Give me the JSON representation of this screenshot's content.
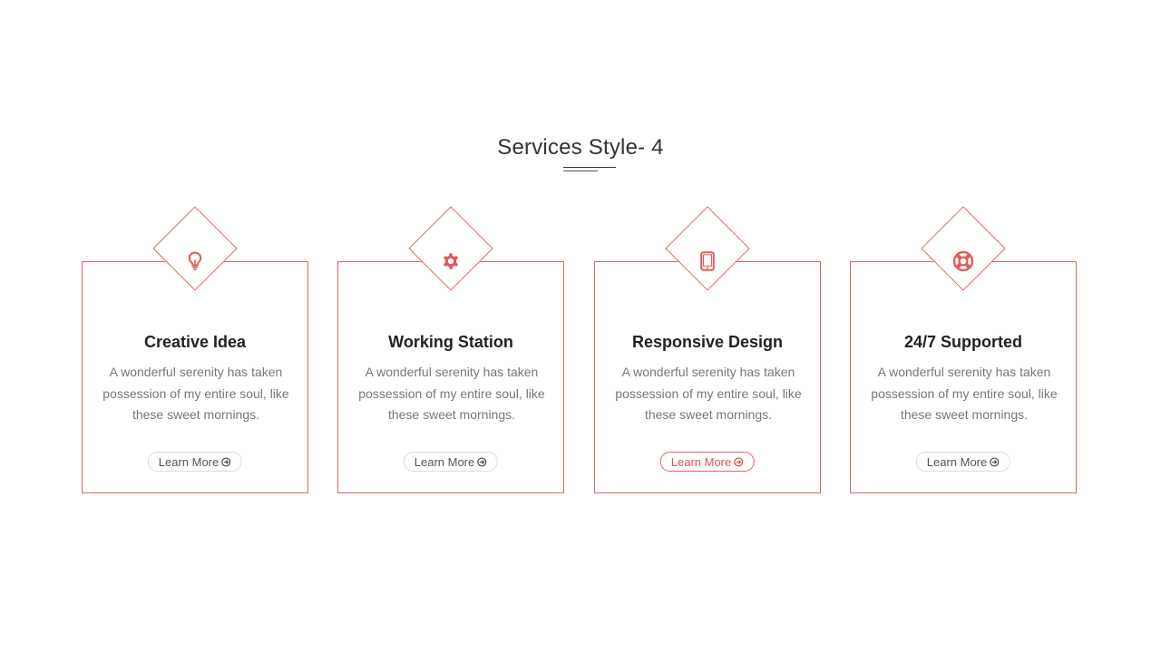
{
  "section": {
    "title": "Services Style- 4"
  },
  "colors": {
    "accent": "#e35a5a",
    "border": "#e06666",
    "title_text": "#333333",
    "body_text": "#777777"
  },
  "cards": [
    {
      "icon": "lightbulb-icon",
      "title": "Creative Idea",
      "text": "A wonderful serenity has taken possession of my entire soul, like these sweet mornings.",
      "button_label": "Learn More",
      "button_active": false
    },
    {
      "icon": "gear-icon",
      "title": "Working Station",
      "text": "A wonderful serenity has taken possession of my entire soul, like these sweet mornings.",
      "button_label": "Learn More",
      "button_active": false
    },
    {
      "icon": "tablet-icon",
      "title": "Responsive Design",
      "text": "A wonderful serenity has taken possession of my entire soul, like these sweet mornings.",
      "button_label": "Learn More",
      "button_active": true
    },
    {
      "icon": "lifebuoy-icon",
      "title": "24/7 Supported",
      "text": "A wonderful serenity has taken possession of my entire soul, like these sweet mornings.",
      "button_label": "Learn More",
      "button_active": false
    }
  ]
}
